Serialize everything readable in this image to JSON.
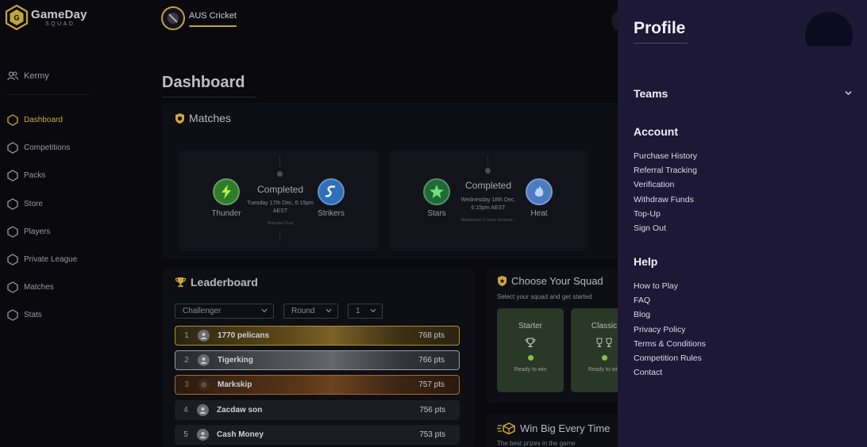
{
  "brand": {
    "name": "GameDay",
    "sub": "SQUAD"
  },
  "user": {
    "name": "Kermy"
  },
  "sidebar": {
    "items": [
      {
        "label": "Dashboard",
        "active": true
      },
      {
        "label": "Competitions"
      },
      {
        "label": "Packs"
      },
      {
        "label": "Store"
      },
      {
        "label": "Players"
      },
      {
        "label": "Private League"
      },
      {
        "label": "Matches"
      },
      {
        "label": "Stats"
      }
    ]
  },
  "header": {
    "tab_label": "AUS Cricket"
  },
  "page": {
    "title": "Dashboard"
  },
  "matches": {
    "heading": "Matches",
    "items": [
      {
        "home": "Thunder",
        "away": "Strikers",
        "status": "Completed",
        "date": "Tuesday 17th Dec, 6:15pm AEST",
        "venue": "Manuka Oval"
      },
      {
        "home": "Stars",
        "away": "Heat",
        "status": "Completed",
        "date": "Wednesday 18th Dec, 6:15pm AEST",
        "venue": "Melbourne Cricket Ground..."
      }
    ]
  },
  "leaderboard": {
    "heading": "Leaderboard",
    "filters": {
      "competition": "Challenger",
      "round": "Round",
      "number": "1"
    },
    "rows": [
      {
        "rank": "1",
        "name": "1770 pelicans",
        "points": "768 pts"
      },
      {
        "rank": "2",
        "name": "Tigerking",
        "points": "766 pts"
      },
      {
        "rank": "3",
        "name": "Markskip",
        "points": "757 pts"
      },
      {
        "rank": "4",
        "name": "Zacdaw son",
        "points": "756 pts"
      },
      {
        "rank": "5",
        "name": "Cash Money",
        "points": "753 pts"
      }
    ]
  },
  "squad": {
    "heading": "Choose Your Squad",
    "subtitle": "Select your squad and get started",
    "cards": [
      {
        "title": "Starter",
        "status": "Ready to win"
      },
      {
        "title": "Classic",
        "status": "Ready to win"
      }
    ]
  },
  "win": {
    "heading": "Win Big Every Time",
    "subtitle": "The best prizes in the game"
  },
  "profile": {
    "title": "Profile",
    "teams_label": "Teams",
    "account": {
      "heading": "Account",
      "links": [
        "Purchase History",
        "Referral Tracking",
        "Verification",
        "Withdraw Funds",
        "Top-Up",
        "Sign Out"
      ]
    },
    "help": {
      "heading": "Help",
      "links": [
        "How to Play",
        "FAQ",
        "Blog",
        "Privacy Policy",
        "Terms & Conditions",
        "Competition Rules",
        "Contact"
      ]
    }
  },
  "colors": {
    "accent_gold": "#c9a93a",
    "profile_bg": "#1c1836",
    "squad_card": "#2a3827",
    "ready_dot": "#7ec24a"
  }
}
